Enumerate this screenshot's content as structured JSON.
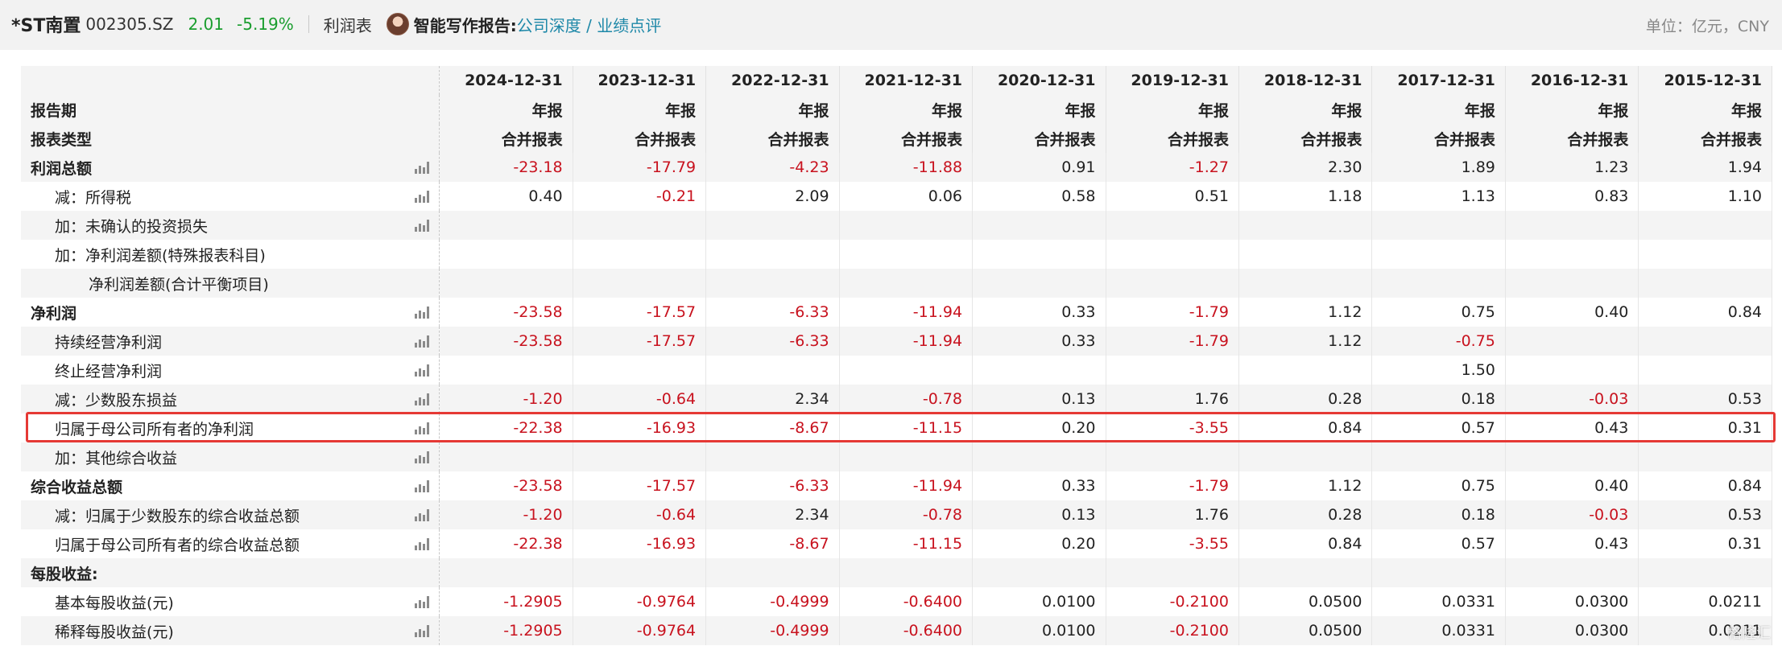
{
  "header": {
    "stock_name": "*ST南置",
    "stock_code": "002305.SZ",
    "price": "2.01",
    "change_pct": "-5.19%",
    "report_name": "利润表",
    "ai_label": "智能写作报告:",
    "ai_link": "公司深度 / 业绩点评",
    "unit": "单位：亿元，CNY"
  },
  "table": {
    "header_labels": [
      "报告期",
      "报表类型"
    ],
    "periods": [
      {
        "date": "2024-12-31",
        "type": "年报",
        "kind": "合并报表"
      },
      {
        "date": "2023-12-31",
        "type": "年报",
        "kind": "合并报表"
      },
      {
        "date": "2022-12-31",
        "type": "年报",
        "kind": "合并报表"
      },
      {
        "date": "2021-12-31",
        "type": "年报",
        "kind": "合并报表"
      },
      {
        "date": "2020-12-31",
        "type": "年报",
        "kind": "合并报表"
      },
      {
        "date": "2019-12-31",
        "type": "年报",
        "kind": "合并报表"
      },
      {
        "date": "2018-12-31",
        "type": "年报",
        "kind": "合并报表"
      },
      {
        "date": "2017-12-31",
        "type": "年报",
        "kind": "合并报表"
      },
      {
        "date": "2016-12-31",
        "type": "年报",
        "kind": "合并报表"
      },
      {
        "date": "2015-12-31",
        "type": "年报",
        "kind": "合并报表"
      }
    ],
    "rows": [
      {
        "label": "利润总额",
        "indent": 0,
        "bold": true,
        "chart": true,
        "values": [
          "-23.18",
          "-17.79",
          "-4.23",
          "-11.88",
          "0.91",
          "-1.27",
          "2.30",
          "1.89",
          "1.23",
          "1.94"
        ]
      },
      {
        "label": "减：所得税",
        "indent": 1,
        "bold": false,
        "chart": true,
        "values": [
          "0.40",
          "-0.21",
          "2.09",
          "0.06",
          "0.58",
          "0.51",
          "1.18",
          "1.13",
          "0.83",
          "1.10"
        ]
      },
      {
        "label": "加：未确认的投资损失",
        "indent": 1,
        "bold": false,
        "chart": true,
        "values": [
          "",
          "",
          "",
          "",
          "",
          "",
          "",
          "",
          "",
          ""
        ]
      },
      {
        "label": "加：净利润差额(特殊报表科目)",
        "indent": 1,
        "bold": false,
        "chart": false,
        "values": [
          "",
          "",
          "",
          "",
          "",
          "",
          "",
          "",
          "",
          ""
        ]
      },
      {
        "label": "净利润差额(合计平衡项目)",
        "indent": 2,
        "bold": false,
        "chart": false,
        "values": [
          "",
          "",
          "",
          "",
          "",
          "",
          "",
          "",
          "",
          ""
        ]
      },
      {
        "label": "净利润",
        "indent": 0,
        "bold": true,
        "chart": true,
        "values": [
          "-23.58",
          "-17.57",
          "-6.33",
          "-11.94",
          "0.33",
          "-1.79",
          "1.12",
          "0.75",
          "0.40",
          "0.84"
        ]
      },
      {
        "label": "持续经营净利润",
        "indent": 1,
        "bold": false,
        "chart": true,
        "values": [
          "-23.58",
          "-17.57",
          "-6.33",
          "-11.94",
          "0.33",
          "-1.79",
          "1.12",
          "-0.75",
          "",
          ""
        ]
      },
      {
        "label": "终止经营净利润",
        "indent": 1,
        "bold": false,
        "chart": true,
        "values": [
          "",
          "",
          "",
          "",
          "",
          "",
          "",
          "1.50",
          "",
          ""
        ]
      },
      {
        "label": "减：少数股东损益",
        "indent": 1,
        "bold": false,
        "chart": true,
        "values": [
          "-1.20",
          "-0.64",
          "2.34",
          "-0.78",
          "0.13",
          "1.76",
          "0.28",
          "0.18",
          "-0.03",
          "0.53"
        ]
      },
      {
        "label": "归属于母公司所有者的净利润",
        "indent": 1,
        "bold": false,
        "chart": true,
        "values": [
          "-22.38",
          "-16.93",
          "-8.67",
          "-11.15",
          "0.20",
          "-3.55",
          "0.84",
          "0.57",
          "0.43",
          "0.31"
        ]
      },
      {
        "label": "加：其他综合收益",
        "indent": 1,
        "bold": false,
        "chart": true,
        "values": [
          "",
          "",
          "",
          "",
          "",
          "",
          "",
          "",
          "",
          ""
        ]
      },
      {
        "label": "综合收益总额",
        "indent": 0,
        "bold": true,
        "chart": true,
        "values": [
          "-23.58",
          "-17.57",
          "-6.33",
          "-11.94",
          "0.33",
          "-1.79",
          "1.12",
          "0.75",
          "0.40",
          "0.84"
        ]
      },
      {
        "label": "减：归属于少数股东的综合收益总额",
        "indent": 1,
        "bold": false,
        "chart": true,
        "values": [
          "-1.20",
          "-0.64",
          "2.34",
          "-0.78",
          "0.13",
          "1.76",
          "0.28",
          "0.18",
          "-0.03",
          "0.53"
        ]
      },
      {
        "label": "归属于母公司所有者的综合收益总额",
        "indent": 1,
        "bold": false,
        "chart": true,
        "values": [
          "-22.38",
          "-16.93",
          "-8.67",
          "-11.15",
          "0.20",
          "-3.55",
          "0.84",
          "0.57",
          "0.43",
          "0.31"
        ]
      },
      {
        "label": "每股收益:",
        "indent": 0,
        "bold": true,
        "chart": false,
        "values": [
          "",
          "",
          "",
          "",
          "",
          "",
          "",
          "",
          "",
          ""
        ]
      },
      {
        "label": "基本每股收益(元)",
        "indent": 1,
        "bold": false,
        "chart": true,
        "values": [
          "-1.2905",
          "-0.9764",
          "-0.4999",
          "-0.6400",
          "0.0100",
          "-0.2100",
          "0.0500",
          "0.0331",
          "0.0300",
          "0.0211"
        ]
      },
      {
        "label": "稀释每股收益(元)",
        "indent": 1,
        "bold": false,
        "chart": true,
        "values": [
          "-1.2905",
          "-0.9764",
          "-0.4999",
          "-0.6400",
          "0.0100",
          "-0.2100",
          "0.0500",
          "0.0331",
          "0.0300",
          "0.0211"
        ]
      }
    ],
    "highlighted_row": "归属于母公司所有者的净利润"
  },
  "watermark": "格隆汇",
  "colors": {
    "negative": "#c8121e",
    "positive_change": "#1a9d2e",
    "link": "#1e88a8",
    "highlight_border": "#e53935"
  }
}
